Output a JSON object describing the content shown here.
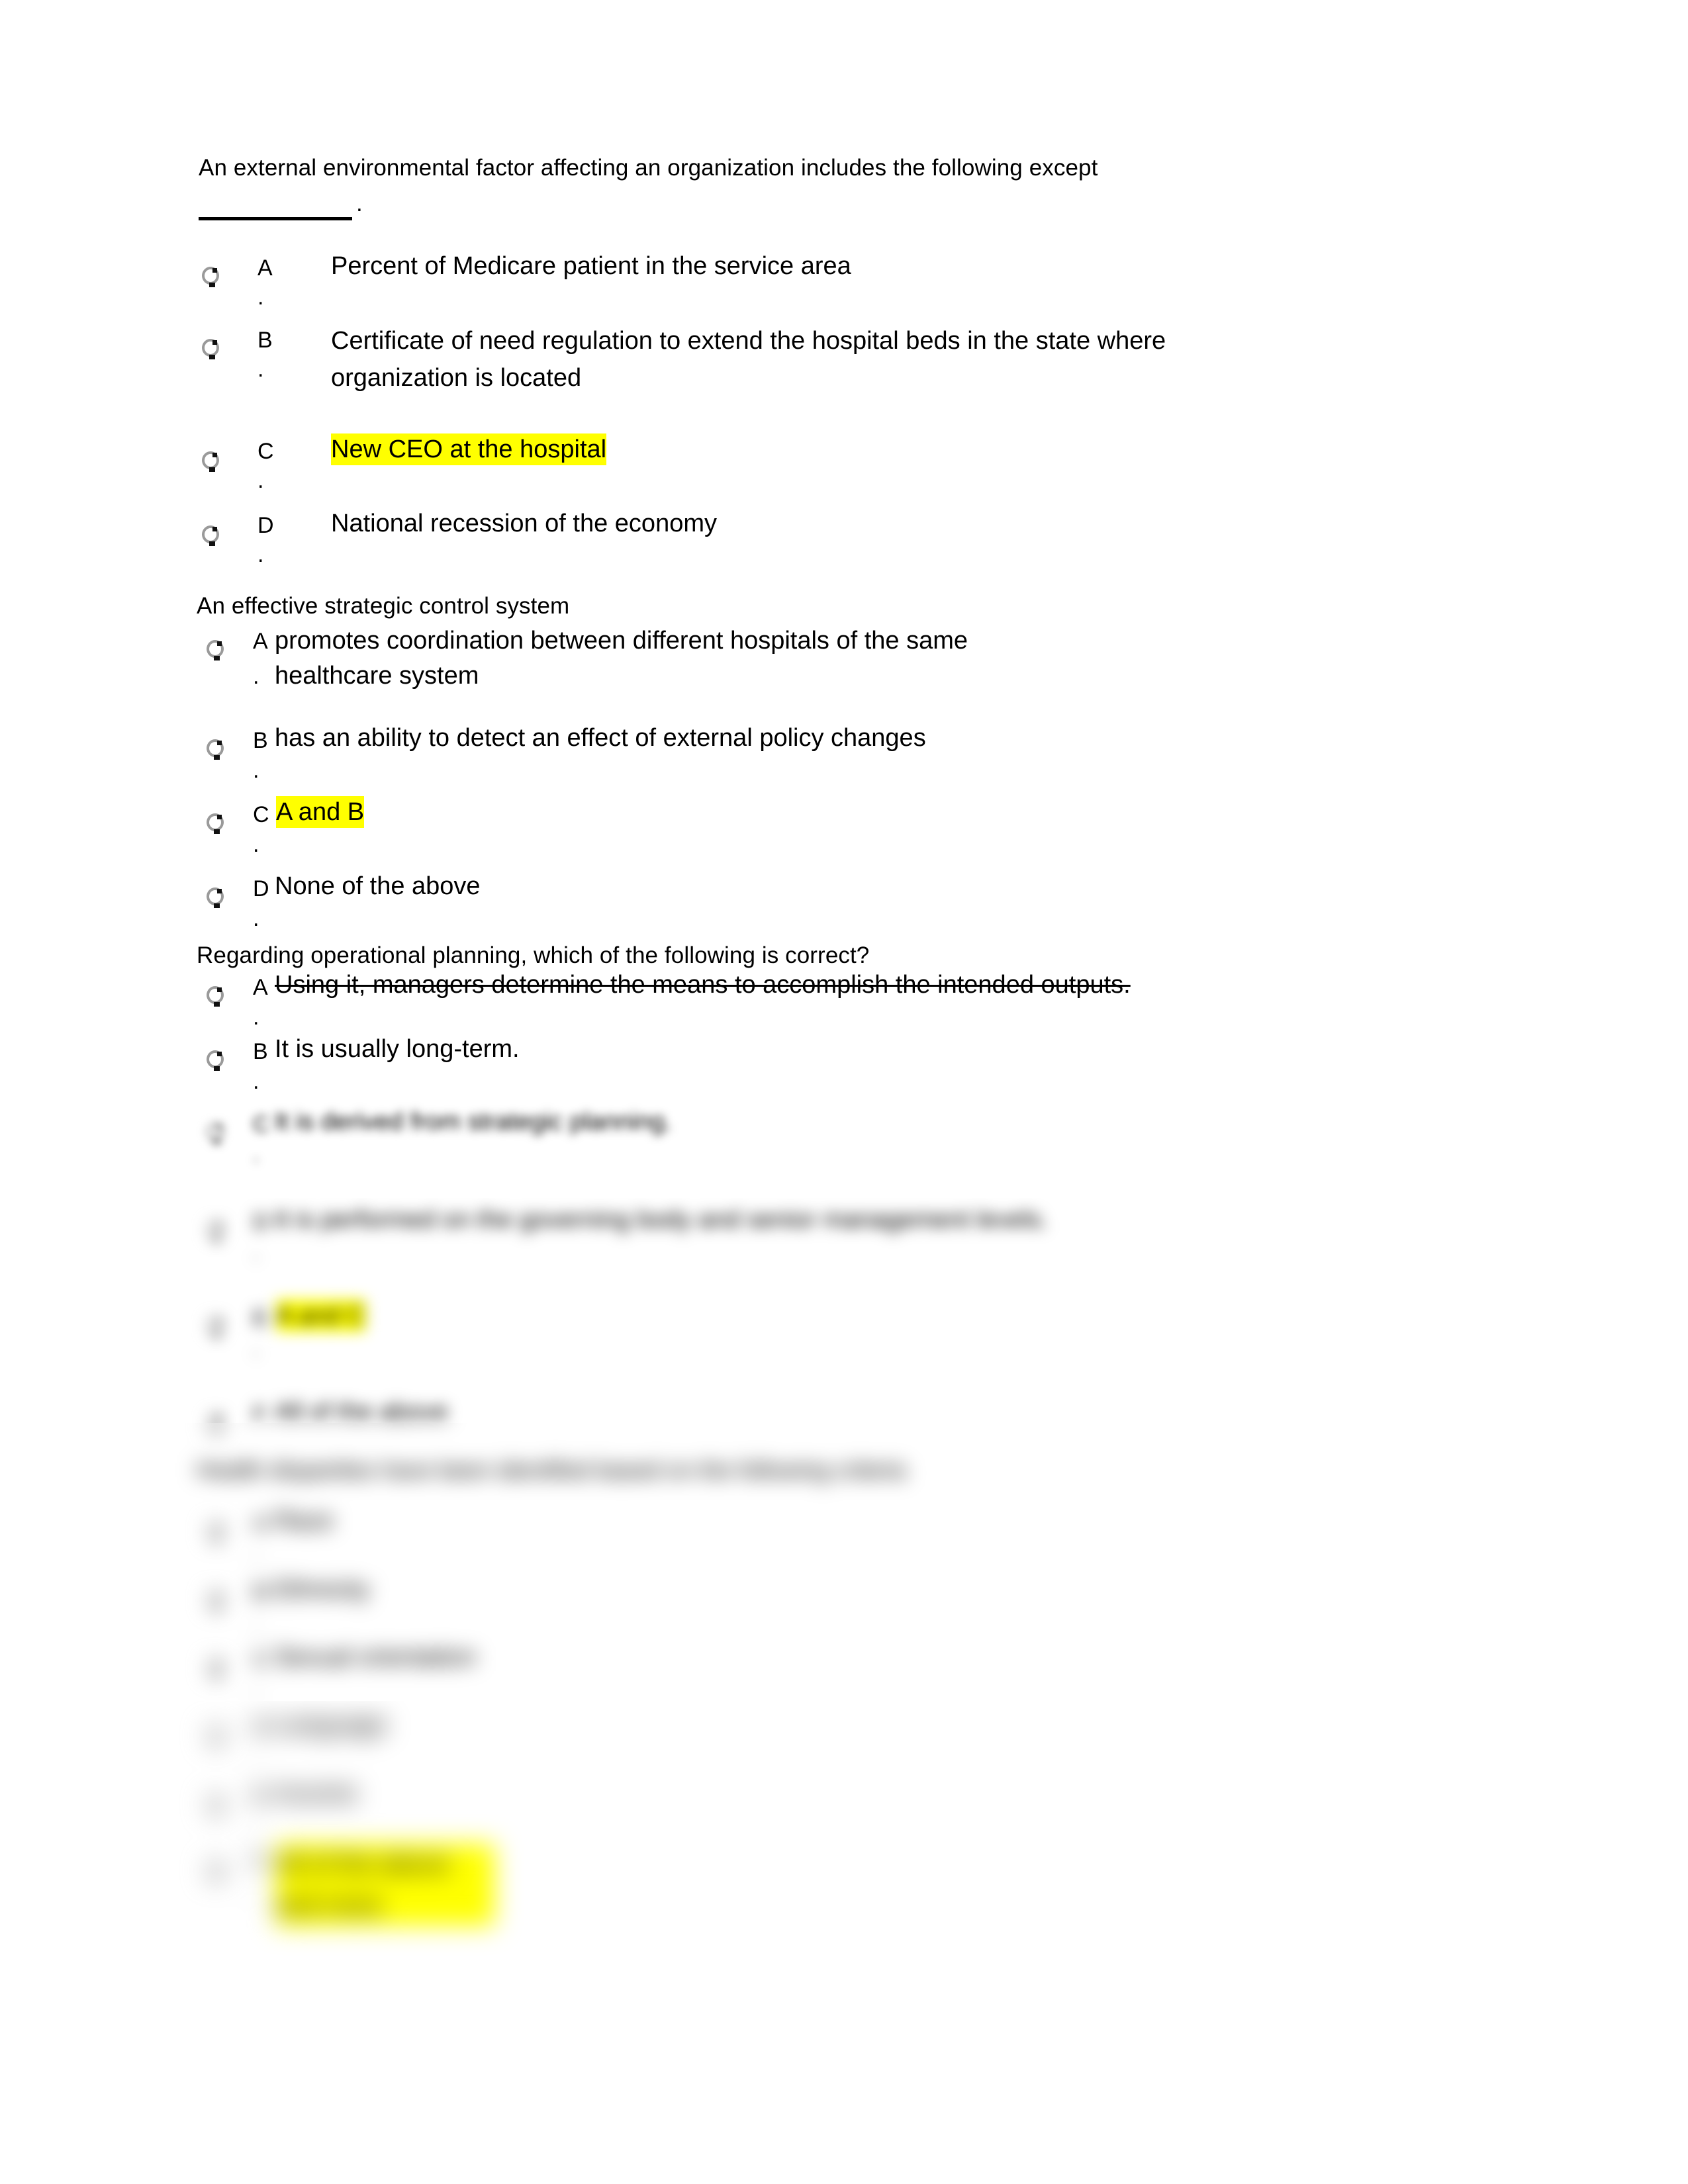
{
  "document": {
    "type": "multiple-choice-quiz",
    "highlight_color": "#FFFF00",
    "page_background": "#FFFFFF",
    "text_color": "#000000"
  },
  "questions": [
    {
      "id": "q1",
      "prompt_line1": "An external environmental factor affecting an organization includes the following except",
      "prompt_blank": "__________",
      "prompt_blank_period": ".",
      "options": [
        {
          "letter": "A",
          "period": ".",
          "text": "Percent of Medicare patient in the service area",
          "highlighted": false,
          "struck": false
        },
        {
          "letter": "B",
          "period": ".",
          "text": "Certificate of need regulation to extend the hospital beds in the state where organization is located",
          "highlighted": false,
          "struck": false
        },
        {
          "letter": "C",
          "period": ".",
          "text": "New CEO at the hospital",
          "highlighted": true,
          "struck": false
        },
        {
          "letter": "D",
          "period": ".",
          "text": "National recession of the economy",
          "highlighted": false,
          "struck": false
        }
      ]
    },
    {
      "id": "q2",
      "prompt_line1": "An effective strategic control system",
      "options": [
        {
          "letter": "A",
          "period": ".",
          "text": "promotes coordination between different hospitals of the same healthcare system",
          "highlighted": false,
          "struck": false
        },
        {
          "letter": "B",
          "period": ".",
          "text": "has an ability to detect an effect of external policy changes",
          "highlighted": false,
          "struck": false
        },
        {
          "letter": "C",
          "period": ".",
          "text": "A and B",
          "highlighted": true,
          "struck": false
        },
        {
          "letter": "D",
          "period": ".",
          "text": "None of the above",
          "highlighted": false,
          "struck": false
        }
      ]
    },
    {
      "id": "q3",
      "prompt_line1": "Regarding operational planning, which of the following is correct?",
      "options": [
        {
          "letter": "A",
          "period": ".",
          "text": "Using it, managers determine the means to accomplish the intended outputs.",
          "highlighted": false,
          "struck": true
        },
        {
          "letter": "B",
          "period": ".",
          "text": "It is usually long-term.",
          "highlighted": false,
          "struck": false
        },
        {
          "letter": "C",
          "period": ".",
          "text": "It is derived from strategic planning.",
          "highlighted": false,
          "struck": false
        },
        {
          "letter": "D",
          "period": ".",
          "text": "It is performed on the governing body and senior management levels.",
          "highlighted": false,
          "struck": false
        },
        {
          "letter": "E",
          "period": ".",
          "text": "A and C",
          "highlighted": true,
          "struck": false
        },
        {
          "letter": "F",
          "period": ".",
          "text": "All of the above",
          "highlighted": false,
          "struck": false
        }
      ]
    },
    {
      "id": "q4",
      "prompt_line1": "Health disparities have been identified based on the following criteria",
      "options": [
        {
          "letter": "A",
          "period": ".",
          "text": "Race",
          "highlighted": false,
          "struck": false
        },
        {
          "letter": "B",
          "period": ".",
          "text": "Ethnicity",
          "highlighted": false,
          "struck": false
        },
        {
          "letter": "C",
          "period": ".",
          "text": "Sexual orientation",
          "highlighted": false,
          "struck": false
        },
        {
          "letter": "D",
          "period": ".",
          "text": "Language",
          "highlighted": false,
          "struck": false
        },
        {
          "letter": "E",
          "period": ".",
          "text": "Income",
          "highlighted": false,
          "struck": false
        },
        {
          "letter": "F",
          "period": ".",
          "text": "All of the above and more",
          "highlighted": true,
          "struck": false
        }
      ]
    }
  ]
}
